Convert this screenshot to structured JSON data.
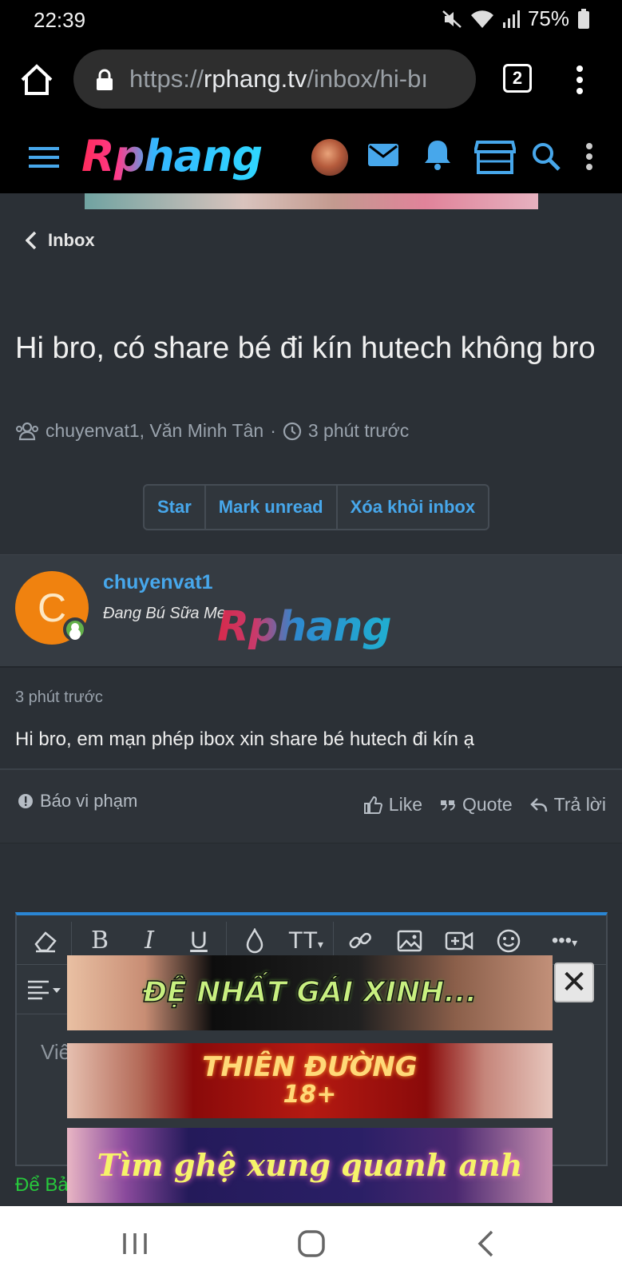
{
  "status": {
    "time": "22:39",
    "battery": "75%"
  },
  "browser": {
    "url_prefix": "https://",
    "url_domain": "rphang.tv",
    "url_path": "/inbox/hi-bı",
    "tab_count": "2"
  },
  "site": {
    "logo_text": "Rphang"
  },
  "page": {
    "back_label": "Inbox",
    "title": "Hi bro, có share bé đi kín hutech không bro",
    "participants": "chuyenvat1, Văn Minh Tân",
    "separator": "·",
    "time_ago": "3 phút trước"
  },
  "actions": {
    "star": "Star",
    "mark_unread": "Mark unread",
    "delete": "Xóa khỏi inbox"
  },
  "message": {
    "avatar_letter": "C",
    "username": "chuyenvat1",
    "user_title": "Đang Bú Sữa Me",
    "watermark": "Rphang",
    "time": "3 phút trước",
    "text": "Hi bro, em mạn phép ibox xin share bé hutech đi kín ạ",
    "report": "Báo vi phạm",
    "like": "Like",
    "quote": "Quote",
    "reply": "Trả lời"
  },
  "editor": {
    "placeholder": "Viế",
    "note": "Để Bả"
  },
  "ads": [
    {
      "text": "ĐỆ NHẤT GÁI XINH..."
    },
    {
      "line1": "THIÊN ĐƯỜNG",
      "line2": "18+"
    },
    {
      "text": "Tìm ghệ xung quanh anh"
    }
  ],
  "colors": {
    "accent": "#47a7eb",
    "editor_border": "#2a86d4",
    "background": "#2b3036",
    "online": "#63b04a",
    "note_green": "#27c83c"
  },
  "icons": [
    "home-icon",
    "lock-icon",
    "menu-icon",
    "hamburger-icon",
    "avatar",
    "mail-icon",
    "bell-icon",
    "store-icon",
    "search-icon",
    "users-icon",
    "clock-icon",
    "alert-icon",
    "thumbs-up-icon",
    "quote-icon",
    "reply-icon",
    "eraser-icon",
    "bold-icon",
    "italic-icon",
    "underline-icon",
    "color-drop-icon",
    "text-size-icon",
    "link-icon",
    "image-icon",
    "video-icon",
    "smile-icon",
    "more-icon",
    "align-icon",
    "close-icon"
  ]
}
